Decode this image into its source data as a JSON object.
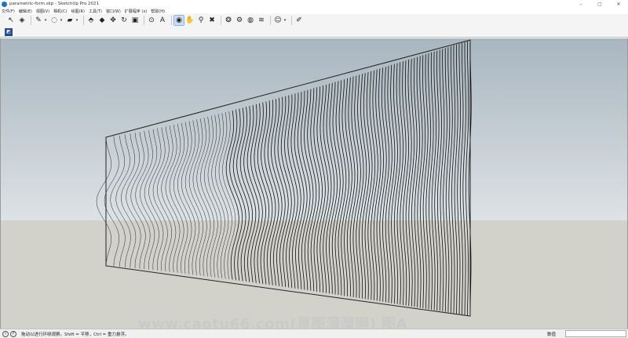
{
  "window": {
    "title": "parametric-form.skp - SketchUp Pro 2021",
    "controls": [
      "–",
      "▢",
      "✕"
    ]
  },
  "menu": [
    "文件(F)",
    "编辑(E)",
    "视图(V)",
    "相机(C)",
    "绘图(R)",
    "工具(T)",
    "窗口(W)",
    "扩展程序 (x)",
    "帮助(H)"
  ],
  "toolbar": {
    "tools": [
      {
        "name": "select-icon",
        "glyph": "↖"
      },
      {
        "name": "eraser-icon",
        "glyph": "◈"
      },
      {
        "name": "pencil-icon",
        "glyph": "✎",
        "dropdown": true
      },
      {
        "name": "shape-icon",
        "glyph": "◌",
        "dropdown": true
      },
      {
        "name": "paint-bucket-icon",
        "glyph": "▰",
        "dropdown": true
      },
      {
        "name": "push-pull-icon",
        "glyph": "⬘"
      },
      {
        "name": "offset-icon",
        "glyph": "◆"
      },
      {
        "name": "move-icon",
        "glyph": "✥"
      },
      {
        "name": "rotate-icon",
        "glyph": "↻"
      },
      {
        "name": "scale-icon",
        "glyph": "▣"
      },
      {
        "name": "tape-measure-icon",
        "glyph": "⊙"
      },
      {
        "name": "text-icon",
        "glyph": "A"
      },
      {
        "name": "orbit-icon",
        "glyph": "◉",
        "active": true
      },
      {
        "name": "pan-icon",
        "glyph": "✋"
      },
      {
        "name": "zoom-icon",
        "glyph": "⚲"
      },
      {
        "name": "zoom-extents-icon",
        "glyph": "✖"
      },
      {
        "name": "warehouse-icon",
        "glyph": "❂"
      },
      {
        "name": "extension-warehouse-icon",
        "glyph": "⚙"
      },
      {
        "name": "sketchup-icon",
        "glyph": "◍"
      },
      {
        "name": "layout-icon",
        "glyph": "≋"
      },
      {
        "name": "account-icon",
        "glyph": "☺",
        "dropdown": true
      },
      {
        "name": "edit-note-icon",
        "glyph": "✐"
      }
    ]
  },
  "toolbar2": {
    "layers_glyph": "◩"
  },
  "statusbar": {
    "status_text": "拖动以进行环绕观察。Shift = 平移，Ctrl = 重力悬浮。",
    "measure_label": "数值",
    "icon_info": "i",
    "icon_help": "?"
  },
  "watermark": "www.caotu66.com(草图溜溜网) 图A",
  "colors": {
    "sky": "#b9c5ce",
    "ground": "#d2d2cb",
    "line": "#111111"
  }
}
